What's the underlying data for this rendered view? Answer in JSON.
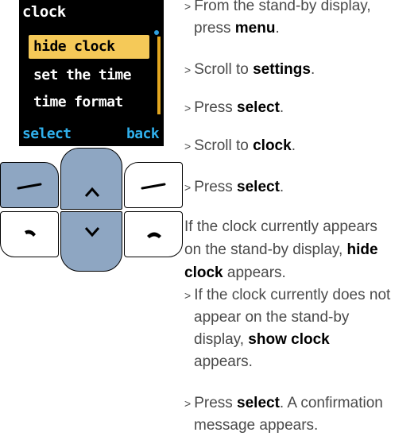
{
  "screen": {
    "title": "clock",
    "items": [
      "hide clock",
      "set the time",
      "time format"
    ],
    "left_soft": "select",
    "right_soft": "back"
  },
  "icons": {
    "left_soft_key": "dash-icon",
    "right_soft_key": "dash-icon",
    "nav_up": "arrow-up-icon",
    "nav_down": "arrow-down-icon",
    "call_key": "handset-pickup-icon",
    "end_key": "handset-hangup-icon"
  },
  "colors": {
    "selected_bg": "#f5c958",
    "soft_label": "#30b0ec",
    "key_blue": "#8ea6c2",
    "scrollbar": "#e2a620"
  },
  "steps": [
    {
      "pre": "From the stand-by display, ",
      "pre2": "press ",
      "kw": "menu",
      "post": "."
    },
    {
      "pre": "Scroll to ",
      "kw": "settings",
      "post": "."
    },
    {
      "pre": "Press ",
      "kw": "select",
      "post": "."
    },
    {
      "pre": "Scroll to ",
      "kw": "clock",
      "post": "."
    },
    {
      "pre": "Press ",
      "kw": "select",
      "post": "."
    }
  ],
  "para": {
    "line1": "If the clock currently appears",
    "line2_pre": "on the stand-by display, ",
    "line2_kw": "hide",
    "line3_kw": "clock",
    "line3_post": " appears."
  },
  "step_b": {
    "line1": "If the clock currently does not",
    "line2": "appear on the stand-by",
    "line3_pre": "display, ",
    "line3_kw": "show clock",
    "line4": "appears."
  },
  "step_c": {
    "pre": "Press ",
    "kw": "select",
    "post": ". A confirmation",
    "line2": "message appears."
  },
  "arrow": ">"
}
